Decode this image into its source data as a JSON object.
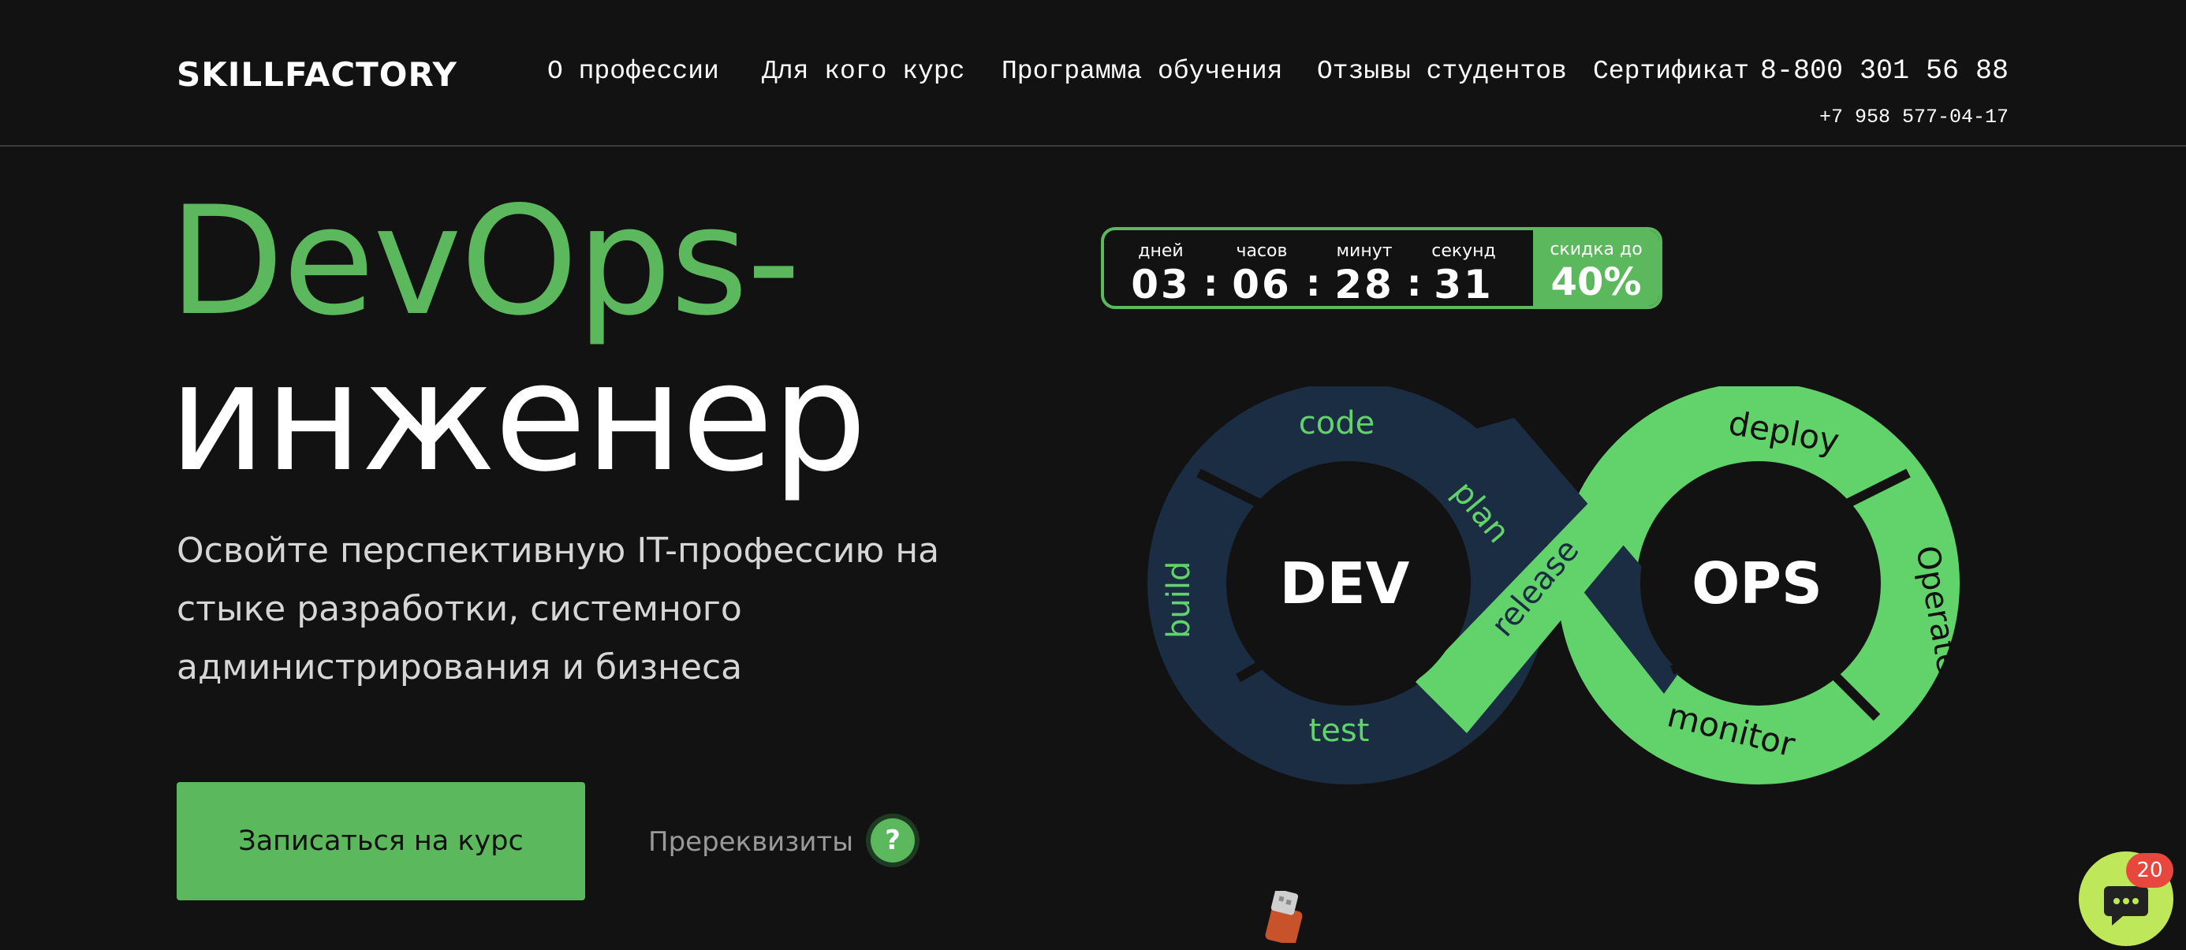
{
  "header": {
    "logo": "SKILLFACTORY",
    "nav": [
      "О профессии",
      "Для кого курс",
      "Программа обучения",
      "Отзывы студентов",
      "Сертификат"
    ],
    "phone_main": "8-800 301 56 88",
    "phone_alt": "+7 958 577-04-17"
  },
  "hero": {
    "title_line1": "DevOps-",
    "title_line2": "инженер",
    "subtitle": "Освойте перспективную IT-профессию на стыке разработки, системного администрирования и бизнеса",
    "cta_label": "Записаться на курс",
    "prereq_label": "Пререквизиты",
    "help_glyph": "?"
  },
  "timer": {
    "units": [
      "дней",
      "часов",
      "минут",
      "секунд"
    ],
    "values": [
      "03",
      "06",
      "28",
      "31"
    ],
    "separator": ":",
    "discount_label": "скидка до",
    "discount_value": "40%"
  },
  "diagram": {
    "dev_label": "DEV",
    "ops_label": "OPS",
    "dev_steps": [
      "code",
      "plan",
      "build",
      "test"
    ],
    "release": "release",
    "ops_steps": [
      "deploy",
      "Operate",
      "monitor"
    ],
    "colors": {
      "dev": "#1a2d42",
      "ops": "#62d36a",
      "dev_text": "#62d36a",
      "ops_text": "#111111"
    }
  },
  "chat": {
    "badge": "20",
    "icon": "chat-bubble-icon"
  },
  "colors": {
    "accent": "#5cb85c",
    "background": "#121212"
  }
}
